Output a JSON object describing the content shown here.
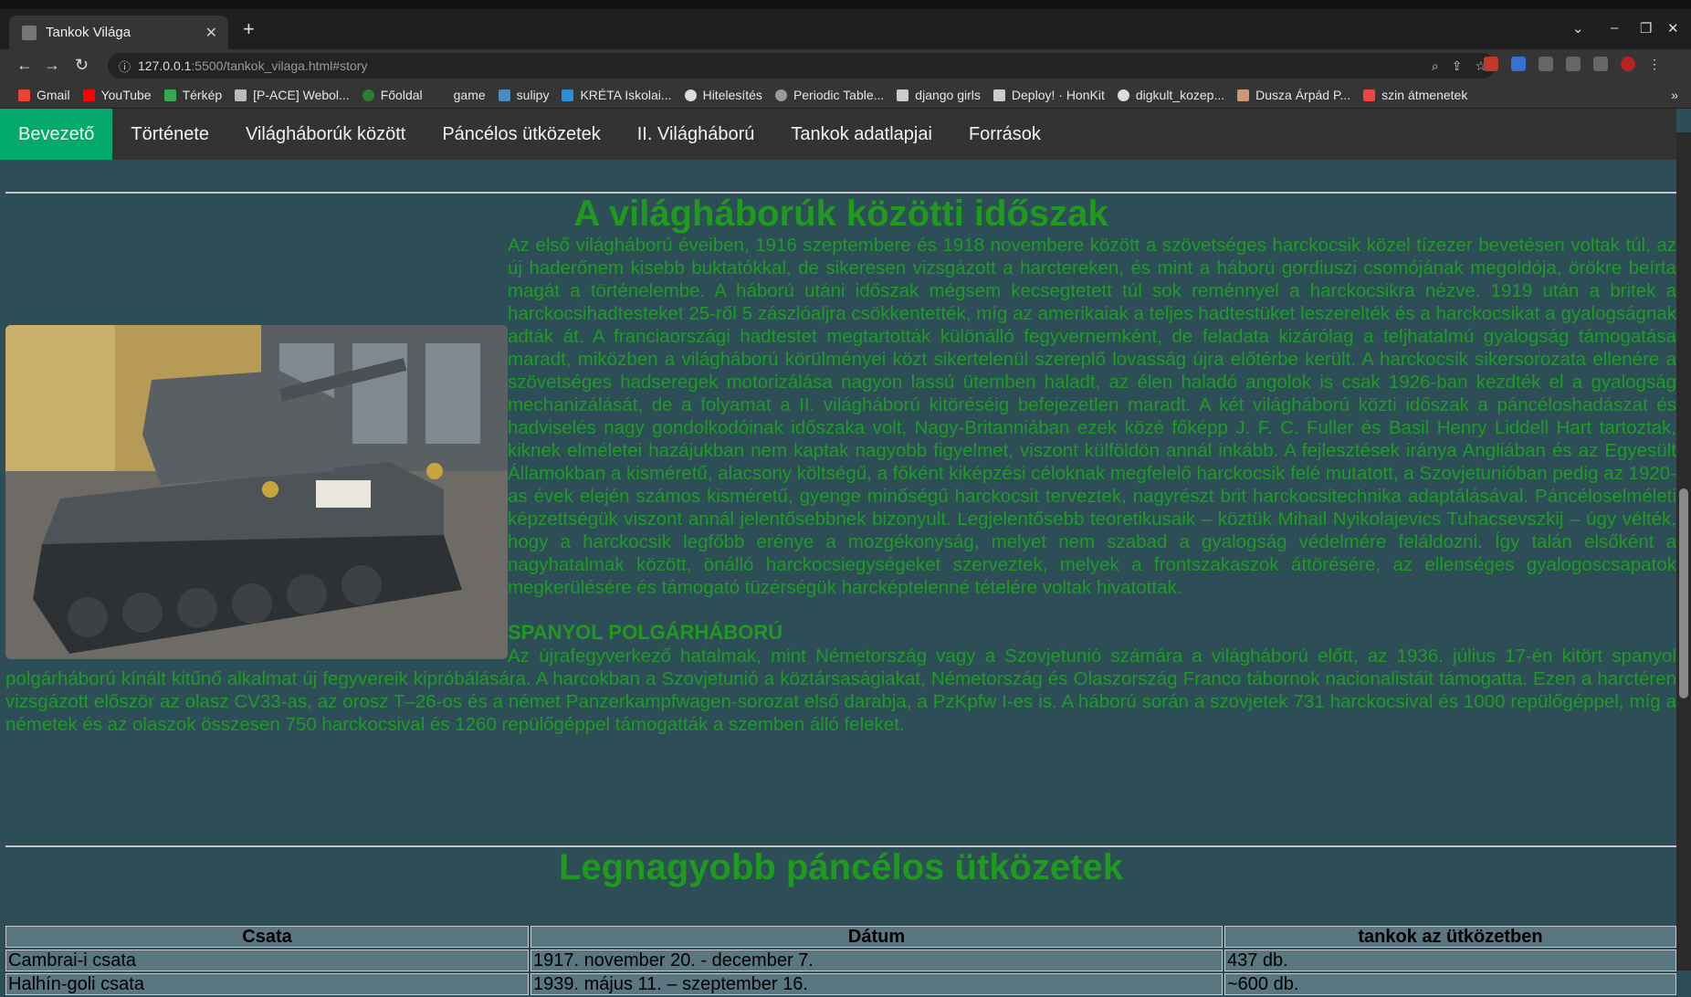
{
  "browser": {
    "tab_title": "Tankok Világa",
    "url_host": "127.0.0.1",
    "url_rest": ":5500/tankok_vilaga.html#story",
    "bookmarks": [
      "Gmail",
      "YouTube",
      "Térkép",
      "[P-ACE] Webol...",
      "Főoldal",
      "game",
      "sulipy",
      "KRÉTA Iskolai...",
      "Hitelesítés",
      "Periodic Table...",
      "django girls",
      "Deploy! · HonKit",
      "digkult_kozep...",
      "Dusza Árpád P...",
      "szin átmenetek"
    ],
    "bookmark_more": "»"
  },
  "nav": {
    "items": [
      "Bevezető",
      "Története",
      "Világháborúk között",
      "Páncélos ütközetek",
      "II. Világháború",
      "Tankok adatlapjai",
      "Források"
    ]
  },
  "section1": {
    "title": "A világháborúk közötti időszak",
    "para1_top": "Az első világháború éveiben, 1916 szeptembere és 1918 novembere között a szövetséges harckocsik közel tízezer bevetésen voltak túl, az új haderőnem kisebb buktatókkal, de sikeresen vizsgázott a harctereken, és mint a háború gordiuszi csomójának megoldója, örökre beírta magát a történelembe. A háború utáni időszak mégsem kecsegtetett túl sok reménnyel a harckocsikra nézve. 1919 után a britek a harckocsihadtesteket 25-ről 5 zászlóaljra csökkentették, míg az amerikaiak a teljes hadtestüket leszerelték és a harckocsikat a gyalogságnak adták át. A franciaországi hadtestet megtartották különálló fegyvernemként, de feladata kizárólag a teljhatalmú gyalogság támogatása maradt, miközben a világháború körülményei közt sikertelenül szereplő lovasság újra előtérbe került. A harckocsik sikersorozata ellenére a szövetséges hadseregek motorizálása nagyon lassú ütemben haladt, az élen haladó angolok is csak 1926-ban kezdték el a gyalogság mechanizálását, de a folyamat a II. világháború kitöréséig befejezetlen maradt. A két világháború közti időszak a páncéloshadászat és hadviselés nagy gondolkodóinak időszaka volt, Nagy-Britanniában ezek közé főképp J. F. C. Fuller és Basil Henry Liddell Hart tartoztak, kiknek elméletei hazájukban nem kaptak nagyobb figyelmet, viszont külföldön annál inkább. A fejlesztések iránya Angliában és az Egyesült Államokban a kisméretű, alacsony költségű, a főként kiképzési céloknak megfelelő harckocsik felé mutatott, a Szovjetunióban pedig az 1920-as évek elején számos kisméretű, gyenge minőségű harckocsit terveztek, nagyrészt brit harckocsitechnika adaptálásával. Páncéloselméleti képzettségük viszont annál jelentősebbnek bizonyult. Legjelentősebb teoretikusaik – köztük Mihail Nyikolajevics Tuhacsevszkij – úgy vélték, hogy a harckocsik legfőbb erénye a mozgékonyság, melyet nem szabad a gyalogság védelmére feláldozni. Így talán elsőként a nagyhatalmak között, önálló harckocsiegységeket szerveztek, melyek a frontszakaszok áttörésére, az ellenséges gyalogoscsapatok megkerülésére és támogató tüzérségük harcképtelenné tételére voltak hivatottak.",
    "sub_title": "SPANYOL POLGÁRHÁBORÚ",
    "para2": "Az újrafegyverkező hatalmak, mint Németország vagy a Szovjetunió számára a világháború előtt, az 1936. július 17-én kitört spanyol polgárháború kínált kitűnő alkalmat új fegyvereik kipróbálására. A harcokban a Szovjetunió a köztársaságiakat, Németország és Olaszország Franco tábornok nacionalistáit támogatta. Ezen a harctéren vizsgázott először az olasz CV33-as, az orosz T–26-os és a német Panzerkampfwagen-sorozat első darabja, a PzKpfw I-es is. A háború során a szovjetek 731 harckocsival és 1000 repülőgéppel, míg a németek és az olaszok összesen 750 harckocsival és 1260 repülőgéppel támogatták a szemben álló feleket."
  },
  "section2": {
    "title": "Legnagyobb páncélos ütközetek",
    "headers": [
      "Csata",
      "Dátum",
      "tankok az ütközetben"
    ],
    "rows": [
      [
        "Cambrai-i csata",
        "1917. november 20. - december 7.",
        "437 db."
      ],
      [
        "Halhín-goli csata",
        "1939. május 11. – szeptember 16.",
        "~600 db."
      ]
    ]
  },
  "colors": {
    "accent_green": "#04aa6d",
    "text_green": "#1e9a25",
    "page_bg": "#2d4e56"
  }
}
